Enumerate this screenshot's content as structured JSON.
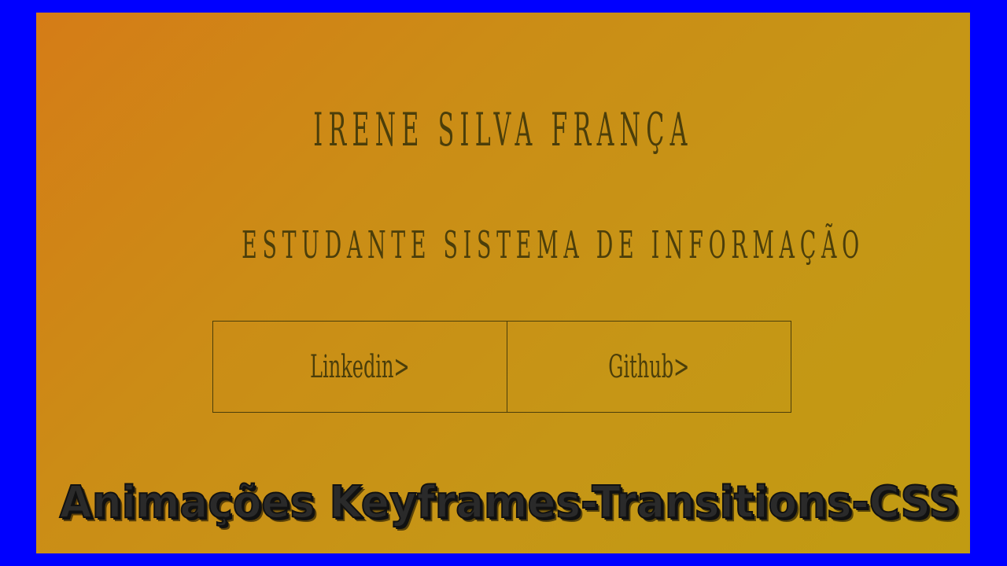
{
  "profile": {
    "name": "IRENE SILVA FRANÇA",
    "title": "ESTUDANTE SISTEMA DE INFORMAÇÃO"
  },
  "links": {
    "linkedin_label": "Linkedin>",
    "github_label": "Github>"
  },
  "banner": {
    "text": "Animações Keyframes-Transitions-CSS"
  },
  "colors": {
    "outer_background": "#0000ff",
    "gradient_start": "#d57c17",
    "gradient_end": "#c19b12",
    "text": "#4b3e0a"
  }
}
